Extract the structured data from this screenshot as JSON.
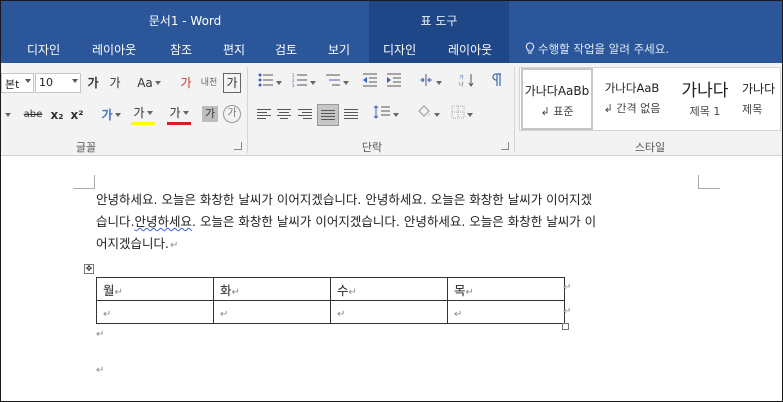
{
  "title": {
    "document": "문서1 - Word",
    "tool_context": "표 도구"
  },
  "tabs": [
    "디자인",
    "레이아웃",
    "참조",
    "편지",
    "검토",
    "보기",
    "디자인",
    "레이아웃"
  ],
  "tell_me": "수행할 작업을 알려 주세요.",
  "ribbon": {
    "font_name": "본t",
    "font_size": "10",
    "font_buttons": [
      "가",
      "가",
      "Aa",
      "가",
      "내천",
      "가"
    ],
    "font_row2": [
      "가",
      "abe",
      "x₂",
      "x²",
      "가",
      "가",
      "가",
      "가",
      "가"
    ],
    "group_font": "글꼴",
    "group_paragraph": "단락",
    "group_styles": "스타일",
    "styles": [
      {
        "sample": "가나다AaBb",
        "name": "↲ 표준"
      },
      {
        "sample": "가나다AaB",
        "name": "↲ 간격 없음"
      },
      {
        "sample": "가나다",
        "name": "제목 1"
      },
      {
        "sample": "가나다",
        "name": "제목"
      }
    ]
  },
  "document": {
    "lines": [
      "안녕하세요. 오늘은 화창한 날씨가 이어지겠습니다. 안녕하세요. 오늘은 화창한 날씨가 이어지겠",
      "습니다.",
      "안녕하세요",
      ". 오늘은 화창한 날씨가 이어지겠습니다. 안녕하세요. 오늘은 화창한 날씨가 이",
      "어지겠습니다."
    ],
    "paragraph_mark": "↵",
    "table": {
      "header": [
        "월",
        "화",
        "수",
        "목"
      ],
      "row2": [
        "",
        "",
        "",
        ""
      ]
    }
  }
}
